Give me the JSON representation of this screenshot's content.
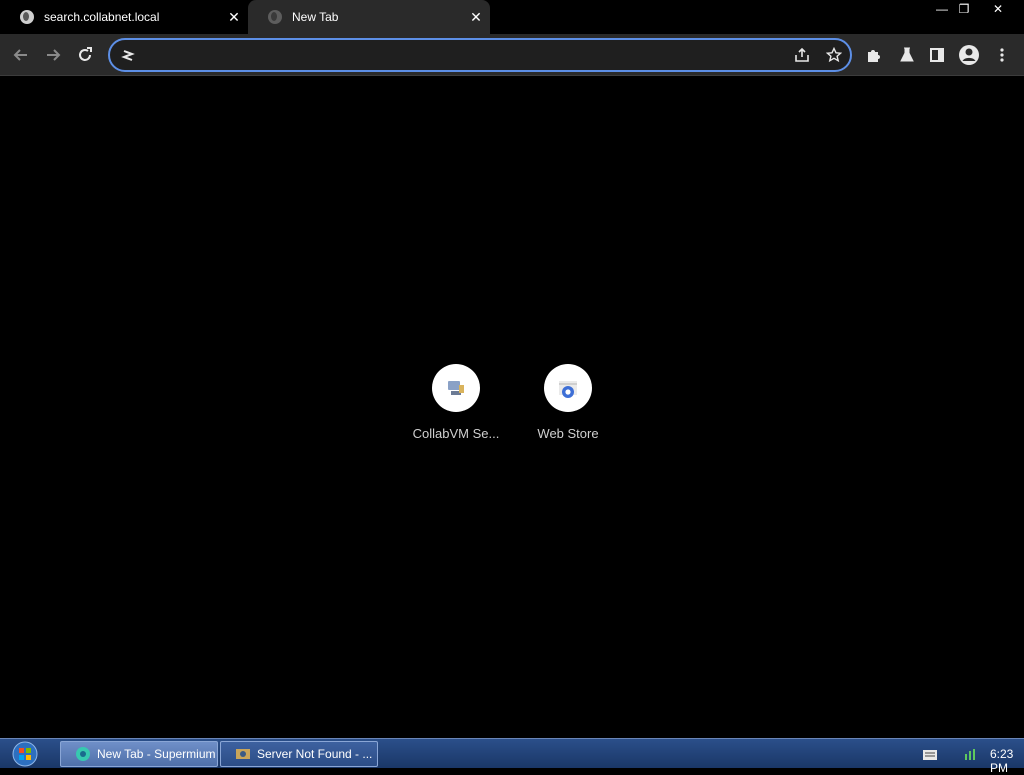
{
  "tabs": [
    {
      "title": "search.collabnet.local"
    },
    {
      "title": "New Tab"
    }
  ],
  "window_controls": {
    "minimize": "—",
    "restore": "❐",
    "close": "✕"
  },
  "omnibox": {
    "value": "",
    "placeholder": ""
  },
  "shortcuts": [
    {
      "label": "CollabVM Se..."
    },
    {
      "label": "Web Store"
    }
  ],
  "taskbar": {
    "items": [
      {
        "label": "New Tab - Supermium"
      },
      {
        "label": "Server Not Found - ..."
      }
    ],
    "clock": "6:23 PM"
  },
  "colors": {
    "accent": "#5d8fe6",
    "toolbar": "#2a2a2a",
    "page_background": "#000000",
    "taskbar": "#1f3f74"
  }
}
